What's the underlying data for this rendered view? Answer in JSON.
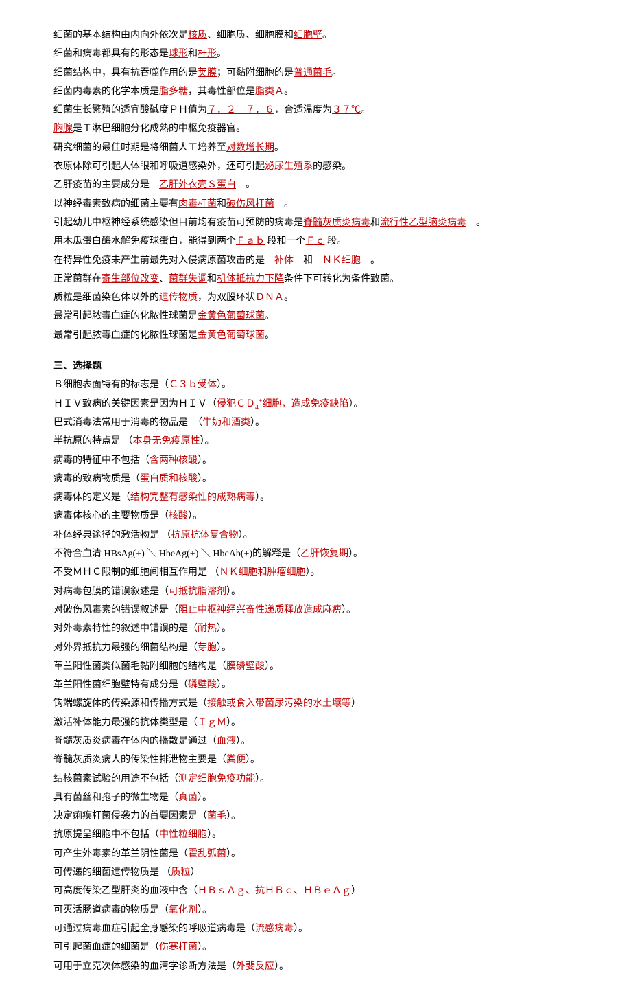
{
  "fill_lines": [
    {
      "segs": [
        {
          "t": "细菌的基本结构由内向外依次是"
        },
        {
          "t": "核质",
          "c": "u"
        },
        {
          "t": "、细胞质、细胞膜和"
        },
        {
          "t": "细胞壁",
          "c": "u"
        },
        {
          "t": "。"
        }
      ]
    },
    {
      "segs": [
        {
          "t": "细菌和病毒都具有的形态是"
        },
        {
          "t": "球形",
          "c": "u"
        },
        {
          "t": "和"
        },
        {
          "t": "杆形",
          "c": "u"
        },
        {
          "t": "。"
        }
      ]
    },
    {
      "segs": [
        {
          "t": "细菌结构中，具有抗吞噬作用的是"
        },
        {
          "t": "荚膜",
          "c": "u"
        },
        {
          "t": "；可黏附细胞的是"
        },
        {
          "t": "普通菌毛",
          "c": "u"
        },
        {
          "t": "。"
        }
      ]
    },
    {
      "segs": [
        {
          "t": "细菌内毒素的化学本质是"
        },
        {
          "t": "脂多糖",
          "c": "u"
        },
        {
          "t": "，其毒性部位是"
        },
        {
          "t": "脂类Ａ",
          "c": "u"
        },
        {
          "t": "。"
        }
      ]
    },
    {
      "segs": [
        {
          "t": "细菌生长繁殖的适宜酸碱度ＰＨ值为"
        },
        {
          "t": "７．２－７．６",
          "c": "u"
        },
        {
          "t": "，合适温度为"
        },
        {
          "t": "３７℃",
          "c": "u"
        },
        {
          "t": "。"
        }
      ]
    },
    {
      "segs": [
        {
          "t": "胸腺",
          "c": "u"
        },
        {
          "t": "是Ｔ淋巴细胞分化成熟的中枢免疫器官。"
        }
      ]
    },
    {
      "segs": [
        {
          "t": "研究细菌的最佳时期是将细菌人工培养至"
        },
        {
          "t": "对数增长期",
          "c": "u"
        },
        {
          "t": "。"
        }
      ]
    },
    {
      "segs": [
        {
          "t": "衣原体除可引起人体眼和呼吸道感染外，还可引起"
        },
        {
          "t": "泌尿生殖系",
          "c": "u"
        },
        {
          "t": "的感染。"
        }
      ]
    },
    {
      "segs": [
        {
          "t": "乙肝疫苗的主要成分是　"
        },
        {
          "t": "乙肝外衣壳Ｓ蛋白",
          "c": "u"
        },
        {
          "t": "　。"
        }
      ]
    },
    {
      "segs": [
        {
          "t": "以神经毒素致病的细菌主要有"
        },
        {
          "t": "肉毒杆菌",
          "c": "u"
        },
        {
          "t": "和"
        },
        {
          "t": "破伤风杆菌",
          "c": "u"
        },
        {
          "t": "　。"
        }
      ]
    },
    {
      "segs": [
        {
          "t": "引起幼儿中枢神经系统感染但目前均有疫苗可预防的病毒是"
        },
        {
          "t": "脊髓灰质炎病毒",
          "c": "u"
        },
        {
          "t": "和"
        },
        {
          "t": "流行性乙型脑炎病毒",
          "c": "u"
        },
        {
          "t": "　。"
        }
      ]
    },
    {
      "segs": [
        {
          "t": "用木瓜蛋白酶水解免疫球蛋白，能得到两个"
        },
        {
          "t": "Ｆａｂ",
          "c": "u"
        },
        {
          "t": " 段和一个"
        },
        {
          "t": "Ｆｃ",
          "c": "u"
        },
        {
          "t": " 段。"
        }
      ]
    },
    {
      "segs": [
        {
          "t": "在特异性免疫未产生前最先对入侵病原菌攻击的是　"
        },
        {
          "t": "补体",
          "c": "u"
        },
        {
          "t": "　和　"
        },
        {
          "t": "ＮＫ细胞",
          "c": "u"
        },
        {
          "t": "　。"
        }
      ]
    },
    {
      "segs": [
        {
          "t": "正常菌群在"
        },
        {
          "t": "寄生部位改变",
          "c": "u"
        },
        {
          "t": "、"
        },
        {
          "t": "菌群失调",
          "c": "u"
        },
        {
          "t": "和"
        },
        {
          "t": "机体抵抗力下降",
          "c": "u"
        },
        {
          "t": "条件下可转化为条件致菌。"
        }
      ]
    },
    {
      "segs": [
        {
          "t": "质粒是细菌染色体以外的"
        },
        {
          "t": "遗传物质",
          "c": "u"
        },
        {
          "t": "，为双股环状"
        },
        {
          "t": "ＤＮＡ",
          "c": "u"
        },
        {
          "t": "。"
        }
      ]
    },
    {
      "segs": [
        {
          "t": "最常引起脓毒血症的化脓性球菌是"
        },
        {
          "t": "金黄色葡萄球菌",
          "c": "u"
        },
        {
          "t": "。"
        }
      ]
    },
    {
      "segs": [
        {
          "t": "最常引起脓毒血症的化脓性球菌是"
        },
        {
          "t": "金黄色葡萄球菌",
          "c": "u"
        },
        {
          "t": "。"
        }
      ]
    }
  ],
  "heading": "三、选择题",
  "mc_lines": [
    {
      "segs": [
        {
          "t": "Ｂ细胞表面特有的标志是（"
        },
        {
          "t": "Ｃ３ｂ受体",
          "c": "red"
        },
        {
          "t": "）。"
        }
      ]
    },
    {
      "segs": [
        {
          "t": "ＨＩＶ致病的关键因素是因为ＨＩＶ（"
        },
        {
          "t": "侵犯ＣＤ",
          "c": "red"
        },
        {
          "t": "4",
          "c": "red",
          "sub": true
        },
        {
          "t": "+",
          "c": "red",
          "sup": true
        },
        {
          "t": "细胞，造成免疫缺陷",
          "c": "red"
        },
        {
          "t": "）。"
        }
      ]
    },
    {
      "segs": [
        {
          "t": "巴式消毒法常用于消毒的物品是　（"
        },
        {
          "t": "牛奶和酒类",
          "c": "red"
        },
        {
          "t": "）。"
        }
      ]
    },
    {
      "segs": [
        {
          "t": "半抗原的特点是 （"
        },
        {
          "t": "本身无免疫原性",
          "c": "red"
        },
        {
          "t": "）。"
        }
      ]
    },
    {
      "segs": [
        {
          "t": "病毒的特征中不包括（"
        },
        {
          "t": "含两种核酸",
          "c": "red"
        },
        {
          "t": "）。"
        }
      ]
    },
    {
      "segs": [
        {
          "t": "病毒的致病物质是（"
        },
        {
          "t": "蛋白质和核酸",
          "c": "red"
        },
        {
          "t": "）。"
        }
      ]
    },
    {
      "segs": [
        {
          "t": "病毒体的定义是（"
        },
        {
          "t": "结构完整有感染性的成熟病毒",
          "c": "red"
        },
        {
          "t": "）。"
        }
      ]
    },
    {
      "segs": [
        {
          "t": "病毒体核心的主要物质是（"
        },
        {
          "t": "核酸",
          "c": "red"
        },
        {
          "t": "）。"
        }
      ]
    },
    {
      "segs": [
        {
          "t": "补体经典途径的激活物是 （"
        },
        {
          "t": "抗原抗体复合物",
          "c": "red"
        },
        {
          "t": "）。"
        }
      ]
    },
    {
      "segs": [
        {
          "t": "不符合血清 HBsAg(+) ＼ HbeAg(+) ＼ HbcAb(+)的解释是（"
        },
        {
          "t": "乙肝恢复期",
          "c": "red"
        },
        {
          "t": "）。"
        }
      ]
    },
    {
      "segs": [
        {
          "t": "不受ＭＨＣ限制的细胞间相互作用是 （"
        },
        {
          "t": "ＮＫ细胞和肿瘤细胞",
          "c": "red"
        },
        {
          "t": "）。"
        }
      ]
    },
    {
      "segs": [
        {
          "t": "对病毒包膜的错误叙述是（"
        },
        {
          "t": "可抵抗脂溶剂",
          "c": "red"
        },
        {
          "t": "）。"
        }
      ]
    },
    {
      "segs": [
        {
          "t": "对破伤风毒素的错误叙述是（"
        },
        {
          "t": "阻止中枢神经兴奋性递质释放造成麻痹",
          "c": "red"
        },
        {
          "t": "）。"
        }
      ]
    },
    {
      "segs": [
        {
          "t": "对外毒素特性的叙述中错误的是（"
        },
        {
          "t": "耐热",
          "c": "red"
        },
        {
          "t": "）。"
        }
      ]
    },
    {
      "segs": [
        {
          "t": "对外界抵抗力最强的细菌结构是（"
        },
        {
          "t": "芽胞",
          "c": "red"
        },
        {
          "t": "）。"
        }
      ]
    },
    {
      "segs": [
        {
          "t": "革兰阳性菌类似菌毛黏附细胞的结构是（"
        },
        {
          "t": "膜磷壁酸",
          "c": "red"
        },
        {
          "t": "）。"
        }
      ]
    },
    {
      "segs": [
        {
          "t": "革兰阳性菌细胞壁特有成分是（"
        },
        {
          "t": "磷壁酸",
          "c": "red"
        },
        {
          "t": "）。"
        }
      ]
    },
    {
      "segs": [
        {
          "t": "钩端螺旋体的传染源和传播方式是（"
        },
        {
          "t": "接触或食入带菌尿污染的水土壤等",
          "c": "red"
        },
        {
          "t": "）"
        }
      ]
    },
    {
      "segs": [
        {
          "t": "激活补体能力最强的抗体类型是（"
        },
        {
          "t": "ＩｇＭ",
          "c": "red"
        },
        {
          "t": "）。"
        }
      ]
    },
    {
      "segs": [
        {
          "t": "脊髓灰质炎病毒在体内的播散是通过（"
        },
        {
          "t": "血液",
          "c": "red"
        },
        {
          "t": "）。"
        }
      ]
    },
    {
      "segs": [
        {
          "t": "脊髓灰质炎病人的传染性排泄物主要是（"
        },
        {
          "t": "粪便",
          "c": "red"
        },
        {
          "t": "）。"
        }
      ]
    },
    {
      "segs": [
        {
          "t": "结核菌素试验的用途不包括（"
        },
        {
          "t": "测定细胞免疫功能",
          "c": "red"
        },
        {
          "t": "）。"
        }
      ]
    },
    {
      "segs": [
        {
          "t": "具有菌丝和孢子的微生物是（"
        },
        {
          "t": "真菌",
          "c": "red"
        },
        {
          "t": "）。"
        }
      ]
    },
    {
      "segs": [
        {
          "t": "决定痢疾杆菌侵袭力的首要因素是（"
        },
        {
          "t": "菌毛",
          "c": "red"
        },
        {
          "t": "）。"
        }
      ]
    },
    {
      "segs": [
        {
          "t": "抗原提呈细胞中不包括（"
        },
        {
          "t": "中性粒细胞",
          "c": "red"
        },
        {
          "t": "）。"
        }
      ]
    },
    {
      "segs": [
        {
          "t": "可产生外毒素的革兰阴性菌是（"
        },
        {
          "t": "霍乱弧菌",
          "c": "red"
        },
        {
          "t": "）。"
        }
      ]
    },
    {
      "segs": [
        {
          "t": "可传递的细菌遗传物质是 （"
        },
        {
          "t": "质粒",
          "c": "red"
        },
        {
          "t": "）"
        }
      ]
    },
    {
      "segs": [
        {
          "t": "可高度传染乙型肝炎的血液中含（"
        },
        {
          "t": "ＨＢｓＡｇ、抗ＨＢｃ、ＨＢｅＡｇ",
          "c": "red"
        },
        {
          "t": "）"
        }
      ]
    },
    {
      "segs": [
        {
          "t": "可灭活肠道病毒的物质是（"
        },
        {
          "t": "氧化剂",
          "c": "red"
        },
        {
          "t": "）。"
        }
      ]
    },
    {
      "segs": [
        {
          "t": "可通过病毒血症引起全身感染的呼吸道病毒是（"
        },
        {
          "t": "流感病毒",
          "c": "red"
        },
        {
          "t": "）。"
        }
      ]
    },
    {
      "segs": [
        {
          "t": "可引起菌血症的细菌是（"
        },
        {
          "t": "伤寒杆菌",
          "c": "red"
        },
        {
          "t": "）。"
        }
      ]
    },
    {
      "segs": [
        {
          "t": "可用于立克次体感染的血清学诊断方法是（"
        },
        {
          "t": "外斐反应",
          "c": "red"
        },
        {
          "t": "）。"
        }
      ]
    }
  ]
}
